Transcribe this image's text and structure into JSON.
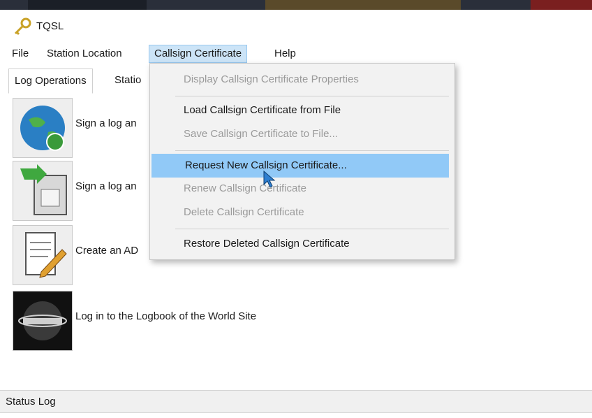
{
  "app": {
    "title": "TQSL"
  },
  "menubar": {
    "items": [
      {
        "label": "File"
      },
      {
        "label": "Station Location"
      },
      {
        "label": "Callsign Certificate"
      },
      {
        "label": "Help"
      }
    ]
  },
  "tabs": [
    {
      "label": "Log Operations"
    },
    {
      "label": "Statio"
    }
  ],
  "operations": [
    {
      "label": "Sign a log an",
      "icon": "globe-icon"
    },
    {
      "label": "Sign a log an",
      "icon": "save-arrow-icon"
    },
    {
      "label": "Create an AD",
      "icon": "edit-document-icon"
    },
    {
      "label": "Log in to the Logbook of the World Site",
      "icon": "logbook-logo-icon"
    }
  ],
  "dropdown": {
    "items": [
      {
        "label": "Display Callsign Certificate Properties",
        "state": "disabled"
      },
      {
        "label": "Load Callsign Certificate from File",
        "state": "enabled"
      },
      {
        "label": "Save Callsign Certificate to File...",
        "state": "disabled"
      },
      {
        "label": "Request New Callsign Certificate...",
        "state": "highlighted"
      },
      {
        "label": "Renew Callsign Certificate",
        "state": "disabled"
      },
      {
        "label": "Delete Callsign Certificate",
        "state": "disabled"
      },
      {
        "label": "Restore Deleted Callsign Certificate",
        "state": "enabled"
      }
    ]
  },
  "status": {
    "label": "Status Log"
  },
  "colors": {
    "menu_highlight": "#91c9f7",
    "active_menu": "#cce4f7"
  }
}
